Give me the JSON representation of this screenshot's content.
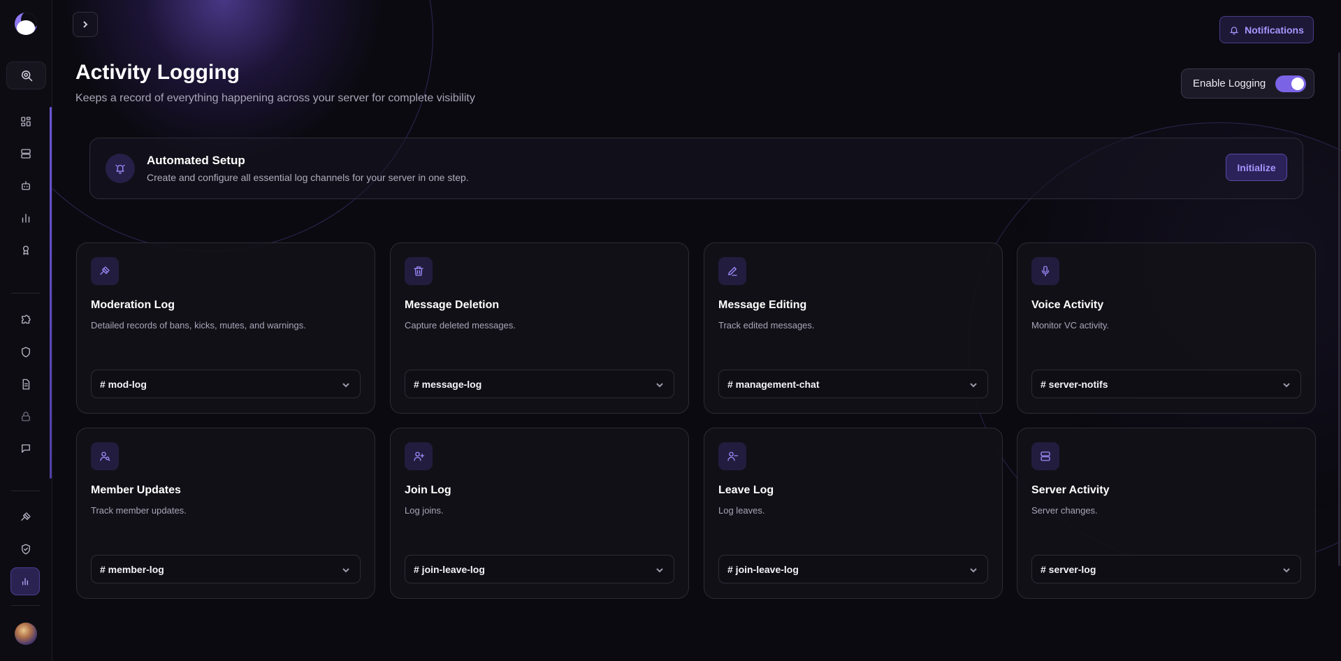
{
  "header": {
    "title": "Activity Logging",
    "subtitle": "Keeps a record of everything happening across your server for complete visibility",
    "notifications_label": "Notifications",
    "enable_logging_label": "Enable Logging",
    "enable_logging_on": true
  },
  "setup": {
    "title": "Automated Setup",
    "description": "Create and configure all essential log channels for your server in one step.",
    "button_label": "Initialize"
  },
  "cards": [
    {
      "title": "Moderation Log",
      "description": "Detailed records of bans, kicks, mutes, and warnings.",
      "channel": "# mod-log",
      "icon": "gavel-icon"
    },
    {
      "title": "Message Deletion",
      "description": "Capture deleted messages.",
      "channel": "# message-log",
      "icon": "trash-icon"
    },
    {
      "title": "Message Editing",
      "description": "Track edited messages.",
      "channel": "# management-chat",
      "icon": "pencil-icon"
    },
    {
      "title": "Voice Activity",
      "description": "Monitor VC activity.",
      "channel": "# server-notifs",
      "icon": "microphone-icon"
    },
    {
      "title": "Member Updates",
      "description": "Track member updates.",
      "channel": "# member-log",
      "icon": "user-search-icon"
    },
    {
      "title": "Join Log",
      "description": "Log joins.",
      "channel": "# join-leave-log",
      "icon": "user-plus-icon"
    },
    {
      "title": "Leave Log",
      "description": "Log leaves.",
      "channel": "# join-leave-log",
      "icon": "user-minus-icon"
    },
    {
      "title": "Server Activity",
      "description": "Server changes.",
      "channel": "# server-log",
      "icon": "server-icon"
    }
  ],
  "sidebar": {
    "icons": [
      "logo",
      "search-icon",
      "dashboard-icon",
      "server-icon",
      "bot-icon",
      "stats-icon",
      "award-icon",
      "puzzle-icon",
      "shield-icon",
      "file-icon",
      "lock-icon",
      "chat-icon",
      "gavel-icon",
      "shield-check-icon",
      "activity-chart-icon",
      "avatar"
    ]
  },
  "colors": {
    "accent": "#7b63e6",
    "accent_text": "#a895ff",
    "background": "#0b0a10",
    "card": "#121118"
  }
}
